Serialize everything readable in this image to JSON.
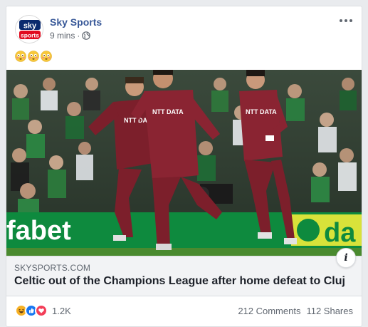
{
  "post": {
    "page_name": "Sky Sports",
    "timestamp": "9 mins",
    "separator": "·",
    "privacy_icon": "globe-icon",
    "more_icon": "more-options-icon",
    "emojis": [
      "flushed-face-emoji",
      "flushed-face-emoji",
      "flushed-face-emoji"
    ]
  },
  "avatar": {
    "logo_text_top": "sky",
    "logo_text_bottom": "sports"
  },
  "image": {
    "description_icon": "football-celebration-photo",
    "ad_text_left": "fabet",
    "ad_text_right": "da",
    "shirt_sponsor": "NTT DATA"
  },
  "link_preview": {
    "domain": "SKYSPORTS.COM",
    "headline": "Celtic out of the Champions League after home defeat to Cluj",
    "info_label": "i"
  },
  "footer": {
    "reaction_count": "1.2K",
    "comments": "212 Comments",
    "shares": "112 Shares",
    "reaction_icons": [
      "haha-reaction-icon",
      "like-reaction-icon",
      "love-reaction-icon"
    ]
  },
  "colors": {
    "page_name": "#385898",
    "sky_red": "#e10a1e",
    "sky_blue": "#0a2a6e",
    "like_blue": "#1877f2",
    "love_red": "#f33e58",
    "haha_yellow": "#f7b125",
    "kit_maroon": "#7c1f2b",
    "pitch_green": "#4a8a2f"
  }
}
